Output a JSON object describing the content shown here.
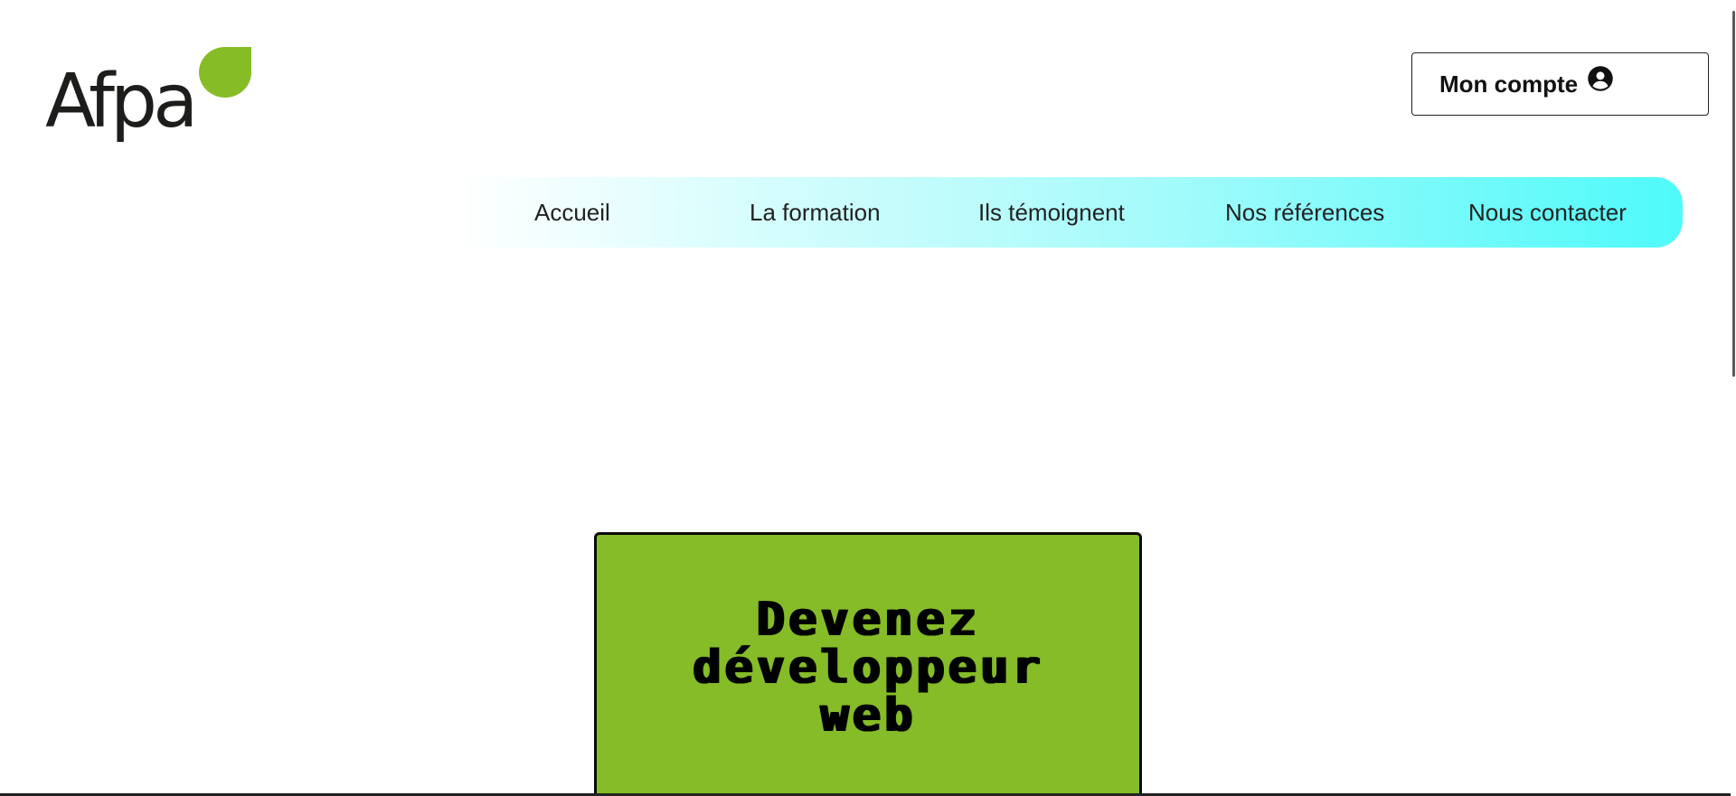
{
  "logo": {
    "text": "Afpa",
    "leaf_color": "#86bc25"
  },
  "account": {
    "label": "Mon compte",
    "icon": "user-circle-icon"
  },
  "nav": {
    "items": [
      {
        "label": "Accueil"
      },
      {
        "label": "La formation"
      },
      {
        "label": "Ils témoignent"
      },
      {
        "label": "Nos références"
      },
      {
        "label": "Nous contacter"
      }
    ],
    "gradient_start": "#ffffff",
    "gradient_end": "#4ffafa"
  },
  "hero": {
    "title_line1": "Devenez",
    "title_line2": "développeur",
    "title_line3": "web",
    "background_color": "#85bc27"
  }
}
